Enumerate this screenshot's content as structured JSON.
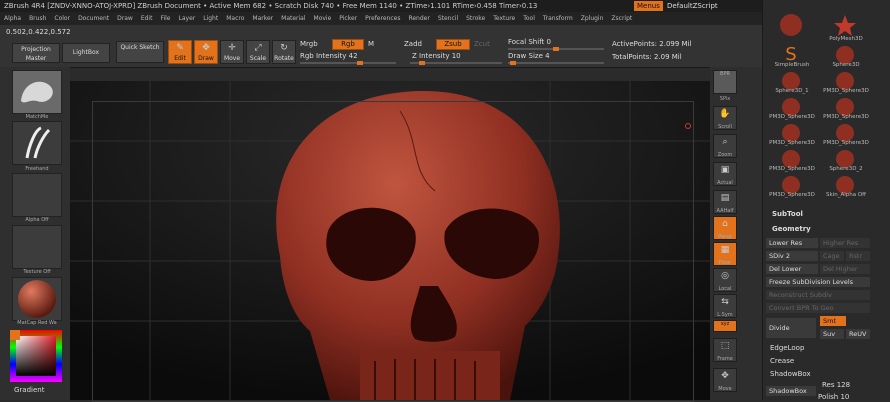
{
  "title_bar": {
    "text": "ZBrush 4R4 [ZNDV-XNNO-ATOJ-XPRD]    ZBrush Document    • Active Mem 682 • Scratch Disk 740 • Free Mem 1140 • ZTime›1.101 RTime›0.458 Timer›0.13",
    "menus_button": "Menus",
    "script_button": "DefaultZScript"
  },
  "menu_bar": [
    "Alpha",
    "Brush",
    "Color",
    "Document",
    "Draw",
    "Edit",
    "File",
    "Layer",
    "Light",
    "Macro",
    "Marker",
    "Material",
    "Movie",
    "Picker",
    "Preferences",
    "Render",
    "Stencil",
    "Stroke",
    "Texture",
    "Tool",
    "Transform",
    "Zplugin",
    "Zscript"
  ],
  "coords": "0.502,0.422,0.572",
  "toolbar": {
    "projection_master": "Projection Master",
    "lightbox": "LightBox",
    "quick_sketch": "Quick Sketch",
    "edit": "Edit",
    "draw": "Draw",
    "move": "Move",
    "scale": "Scale",
    "rotate": "Rotate",
    "mrgb": "Mrgb",
    "rgb": "Rgb",
    "m": "M",
    "zadd": "Zadd",
    "zsub": "Zsub",
    "zcut": "Zcut",
    "rgb_intensity": "Rgb Intensity 42",
    "rgb_intensity_value": 42,
    "z_intensity": "Z Intensity 10",
    "z_intensity_value": 10,
    "focal_shift": "Focal Shift 0",
    "focal_shift_value": 0,
    "draw_size": "Draw Size 4",
    "draw_size_value": 4,
    "active_points": "ActivePoints: 2.099 Mil",
    "total_points": "TotalPoints: 2.09 Mil"
  },
  "left_panel": [
    {
      "label": "MatchMe",
      "icon": "brush-icon"
    },
    {
      "label": "Freehand",
      "icon": "stroke-icon"
    },
    {
      "label": "Alpha Off",
      "icon": "alpha-icon"
    },
    {
      "label": "Texture Off",
      "icon": "texture-icon"
    },
    {
      "label": "MatCap Red Wa",
      "icon": "material-sphere-icon"
    }
  ],
  "gradient_label": "Gradient",
  "right_column": [
    {
      "label": "BPR"
    },
    {
      "label": "SPix"
    },
    {
      "label": "Scroll"
    },
    {
      "label": "Zoom"
    },
    {
      "label": "Actual"
    },
    {
      "label": "AAHalf"
    },
    {
      "label": "Persp",
      "active": true
    },
    {
      "label": "Floor",
      "active": true
    },
    {
      "label": "Local"
    },
    {
      "label": "L.Sym"
    },
    {
      "label": "xyz",
      "active": true
    },
    {
      "label": "Frame"
    },
    {
      "label": "Move"
    }
  ],
  "palette": {
    "tools": [
      {
        "label": "",
        "icon": "skull-tool-icon"
      },
      {
        "label": "PolyMesh3D",
        "icon": "polymesh-star-icon"
      },
      {
        "label": "SimpleBrush",
        "icon": "simplebrush-s-icon"
      },
      {
        "label": "Sphere3D",
        "icon": "sphere-icon"
      },
      {
        "label": "Sphere3D_1",
        "icon": "sphere-icon"
      },
      {
        "label": "PM3D_Sphere3D",
        "icon": "sphere-icon"
      },
      {
        "label": "PM3D_Sphere3D",
        "icon": "sphere-icon"
      },
      {
        "label": "PM3D_Sphere3D",
        "icon": "sphere-icon"
      },
      {
        "label": "PM3D_Sphere3D",
        "icon": "sphere-icon"
      },
      {
        "label": "PM3D_Sphere3D",
        "icon": "sphere-icon"
      },
      {
        "label": "PM3D_Sphere3D",
        "icon": "sphere-icon"
      },
      {
        "label": "Sphere3D_2",
        "icon": "sphere-icon"
      },
      {
        "label": "PM3D_Sphere3D",
        "icon": "sphere-icon"
      },
      {
        "label": "Skin_Alpha Off",
        "icon": "sphere-icon"
      }
    ],
    "subtool": "SubTool",
    "geometry": "Geometry",
    "lower_res": "Lower Res",
    "higher_res": "Higher Res",
    "sdiv": "SDiv 2",
    "cage": "Cage",
    "rstr": "Rstr",
    "del_lower": "Del Lower",
    "del_higher": "Del Higher",
    "freeze": "Freeze SubDivision Levels",
    "reconstruct": "Reconstruct Subdiv",
    "convert_bpr": "Convert BPR To Geo",
    "divide": "Divide",
    "smt": "Smt",
    "suv": "Suv",
    "reuv": "ReUV",
    "edgeloop": "EdgeLoop",
    "crease": "Crease",
    "shadowbox": "ShadowBox",
    "shadowbox_btn": "ShadowBox",
    "res": "Res 128",
    "polish": "Polish 10"
  },
  "colors": {
    "accent": "#e2731c",
    "skull": "#8f2f22"
  }
}
